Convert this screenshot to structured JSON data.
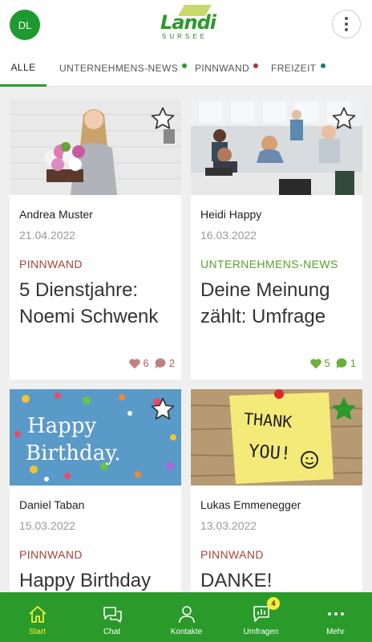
{
  "header": {
    "avatar_initials": "DL",
    "logo_text": "Landi",
    "logo_subtext": "SURSEE",
    "more_icon": "more-vertical-icon"
  },
  "tabs": [
    {
      "label": "ALLE",
      "active": true,
      "dot_color": ""
    },
    {
      "label": "UNTERNEHMENS-NEWS",
      "active": false,
      "dot_color": "#2a9a2a"
    },
    {
      "label": "PINNWAND",
      "active": false,
      "dot_color": "#a33a3a"
    },
    {
      "label": "FREIZEIT",
      "active": false,
      "dot_color": "#1a7a7a"
    }
  ],
  "posts": [
    {
      "author": "Andrea Muster",
      "date": "21.04.2022",
      "category": "PINNWAND",
      "category_color": "#a3453a",
      "title": "5 Dienstjahre: Noemi Schwenk",
      "likes": "6",
      "comments": "2",
      "favorited": false,
      "image": "woman-with-flowers-photo"
    },
    {
      "author": "Heidi Happy",
      "date": "16.03.2022",
      "category": "UNTERNEHMENS-NEWS",
      "category_color": "#5aa02a",
      "title": "Deine Meinung zählt: Umfrage",
      "likes": "5",
      "comments": "1",
      "favorited": false,
      "image": "office-meeting-photo"
    },
    {
      "author": "Daniel Taban",
      "date": "15.03.2022",
      "category": "PINNWAND",
      "category_color": "#a3453a",
      "title": "Happy Birthday",
      "image_text_1": "Happy",
      "image_text_2": "Birthday.",
      "favorited": false,
      "image": "birthday-confetti-image"
    },
    {
      "author": "Lukas Emmenegger",
      "date": "13.03.2022",
      "category": "PINNWAND",
      "category_color": "#a3453a",
      "title": "DANKE!",
      "image_text_1": "THANK",
      "image_text_2": "YOU!",
      "favorited": true,
      "image": "thank-you-note-image"
    }
  ],
  "colors": {
    "brand_green": "#2a9a2a",
    "active_yellow": "#f6ec3a",
    "liked_green": "#5aa02a",
    "liked_red": "#b35a5a"
  },
  "bottom_nav": [
    {
      "label": "Start",
      "icon": "home-icon",
      "active": true
    },
    {
      "label": "Chat",
      "icon": "chat-icon",
      "active": false
    },
    {
      "label": "Kontakte",
      "icon": "person-icon",
      "active": false
    },
    {
      "label": "Umfragen",
      "icon": "poll-icon",
      "active": false,
      "badge": "4"
    },
    {
      "label": "Mehr",
      "icon": "more-horizontal-icon",
      "active": false
    }
  ]
}
